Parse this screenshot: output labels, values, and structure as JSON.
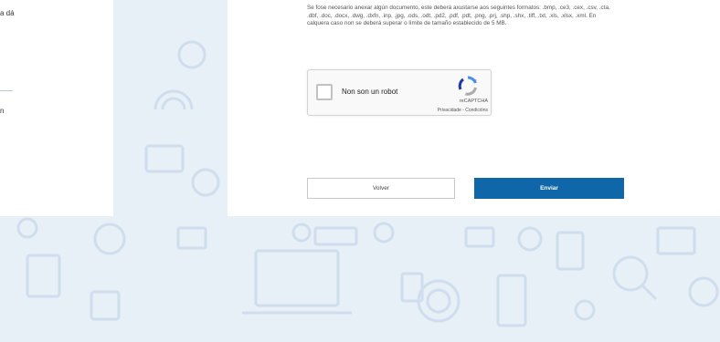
{
  "left_panel": {
    "text_top": "a dá",
    "text_bottom": "n"
  },
  "form": {
    "notice": "Se fose necesario anexar algún documento, este deberá axustarse aos seguintes formatos: .bmp, .ce3, .cex, .csv, .cta, .dbf, .doc, .docx, .dwg, .dxfn, .inp, .jpg, .ods, .odt, .pd2, .pdf, .pdt, .png, .prj, .shp, .shx, .tiff, .txt, .xls, .xlsx, .xml. En calquera caso non se deberá superar o límite de tamaño establecido de 5 MB."
  },
  "captcha": {
    "label": "Non son un robot",
    "brand": "reCAPTCHA",
    "links": "Privacidade - Condicións"
  },
  "buttons": {
    "back": "Volver",
    "send": "Enviar"
  },
  "colors": {
    "primary": "#0f67aa",
    "background": "#e7eff7"
  }
}
